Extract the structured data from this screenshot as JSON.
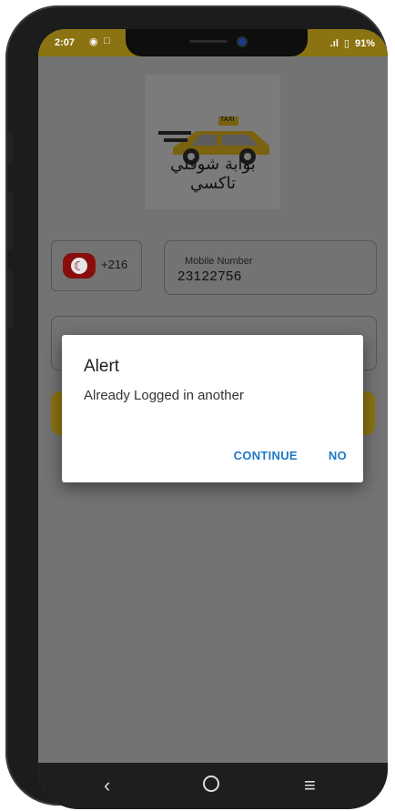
{
  "status_bar": {
    "time": "2:07",
    "left_icons": [
      "notification-icon",
      "screen-icon"
    ],
    "signal": ".ıl",
    "battery_percent": "91%"
  },
  "logo": {
    "badge_text": "TAXI",
    "arabic_text": "بوابة شوفلي تاكسي"
  },
  "login_form": {
    "country_code": "+216",
    "mobile_label": "Mobile Number",
    "mobile_value": "23122756"
  },
  "dialog": {
    "title": "Alert",
    "message": "Already Logged in another",
    "buttons": {
      "continue": "CONTINUE",
      "no": "NO"
    }
  },
  "colors": {
    "accent": "#d9b316",
    "dialog_button": "#1e78c8",
    "overlay": "#737373"
  }
}
